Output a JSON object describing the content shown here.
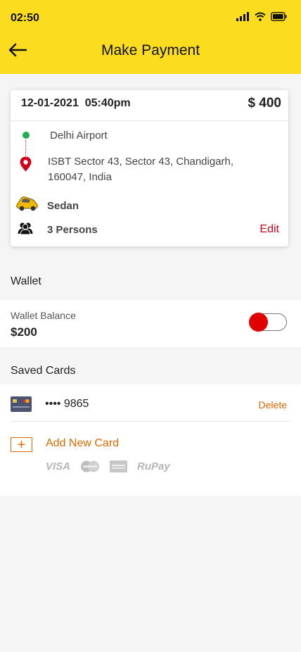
{
  "status_bar": {
    "time": "02:50"
  },
  "header": {
    "title": "Make Payment"
  },
  "trip": {
    "datetime": "12-01-2021  05:40pm",
    "price": "$ 400",
    "pickup": "Delhi Airport",
    "drop": "ISBT Sector 43, Sector 43, Chandigarh, 160047, India",
    "car_type": "Sedan",
    "persons": "3 Persons",
    "edit_label": "Edit"
  },
  "wallet": {
    "section_title": "Wallet",
    "balance_label": "Wallet Balance",
    "balance": "$200",
    "toggle_on": false
  },
  "saved_cards": {
    "section_title": "Saved Cards",
    "cards": [
      {
        "masked_number": "•••• 9865",
        "delete_label": "Delete"
      }
    ],
    "add_label": "Add New Card",
    "brands": [
      "VISA",
      "mastercard",
      "american-express",
      "RuPay"
    ]
  },
  "colors": {
    "header_bg": "#fbdc1f",
    "accent_orange": "#e06a00",
    "toggle_red": "#e00000",
    "edit_red": "#d0021b",
    "pickup_green": "#1fae4b"
  },
  "icons": [
    "back-arrow-icon",
    "signal-icon",
    "wifi-icon",
    "battery-icon",
    "location-pin-icon",
    "car-icon",
    "persons-icon",
    "credit-card-icon",
    "plus-icon"
  ]
}
